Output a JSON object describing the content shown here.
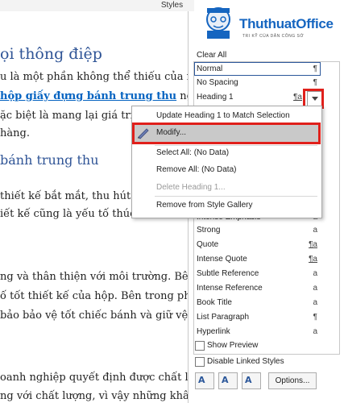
{
  "window": {
    "title": "Styles"
  },
  "logo": {
    "brand": "ThuthuatOffice",
    "tagline": "TRI KỸ CỦA DÂN CÔNG SỞ"
  },
  "document": {
    "lines": [
      {
        "text": "ọi thông điệp",
        "kind": "heading"
      },
      {
        "text": "u là một phần không thể thiếu của n",
        "kind": "body"
      },
      {
        "text_link": "hộp giấy đựng bánh trung thu",
        "text_after": " ngày c",
        "kind": "link"
      },
      {
        "text": "ặc biệt là mang lại giá trị tin",
        "kind": "body"
      },
      {
        "text": "hàng.",
        "kind": "body"
      },
      {
        "text": "bánh trung thu",
        "kind": "heading"
      },
      {
        "text": "thiết kế bắt mắt, thu hút sự",
        "kind": "body"
      },
      {
        "text": "iết kế cũng là yếu tố thúc đẩ",
        "kind": "body"
      },
      {
        "text": "ng và thân thiện với môi trường. Bên",
        "kind": "body"
      },
      {
        "text": "ố tốt thiết kế của hộp. Bên trong phả",
        "kind": "body"
      },
      {
        "text": "bảo bảo vệ tốt chiếc bánh và giữ vệ",
        "kind": "body"
      },
      {
        "text": "oanh nghiệp quyết định được chất lư",
        "kind": "body"
      },
      {
        "text": "ng với chất lượng, vì vậy những khâu",
        "kind": "body"
      }
    ]
  },
  "styles_pane": {
    "clear_all": "Clear All",
    "styles": [
      {
        "name": "Normal",
        "glyph": "¶"
      },
      {
        "name": "No Spacing",
        "glyph": "¶"
      },
      {
        "name": "Heading 1",
        "glyph": "¶a"
      },
      {
        "name": "Intense Emphasis",
        "glyph": "a"
      },
      {
        "name": "Strong",
        "glyph": "a"
      },
      {
        "name": "Quote",
        "glyph": "¶a"
      },
      {
        "name": "Intense Quote",
        "glyph": "¶a"
      },
      {
        "name": "Subtle Reference",
        "glyph": "a"
      },
      {
        "name": "Intense Reference",
        "glyph": "a"
      },
      {
        "name": "Book Title",
        "glyph": "a"
      },
      {
        "name": "List Paragraph",
        "glyph": "¶"
      },
      {
        "name": "Hyperlink",
        "glyph": "a"
      }
    ],
    "show_preview": "Show Preview",
    "disable_linked": "Disable Linked Styles",
    "options_button": "Options..."
  },
  "context_menu": {
    "items": [
      {
        "label": "Update Heading 1 to Match Selection",
        "enabled": true
      },
      {
        "label": "Modify...",
        "enabled": true,
        "highlighted": true
      },
      {
        "label": "Select All: (No Data)",
        "enabled": true
      },
      {
        "label": "Remove All: (No Data)",
        "enabled": true
      },
      {
        "label": "Delete Heading 1...",
        "enabled": false
      },
      {
        "label": "Remove from Style Gallery",
        "enabled": true
      }
    ]
  },
  "colors": {
    "accent": "#2b579a",
    "highlight_border": "#e0201b",
    "heading": "#2f5496",
    "link": "#0563c1"
  }
}
